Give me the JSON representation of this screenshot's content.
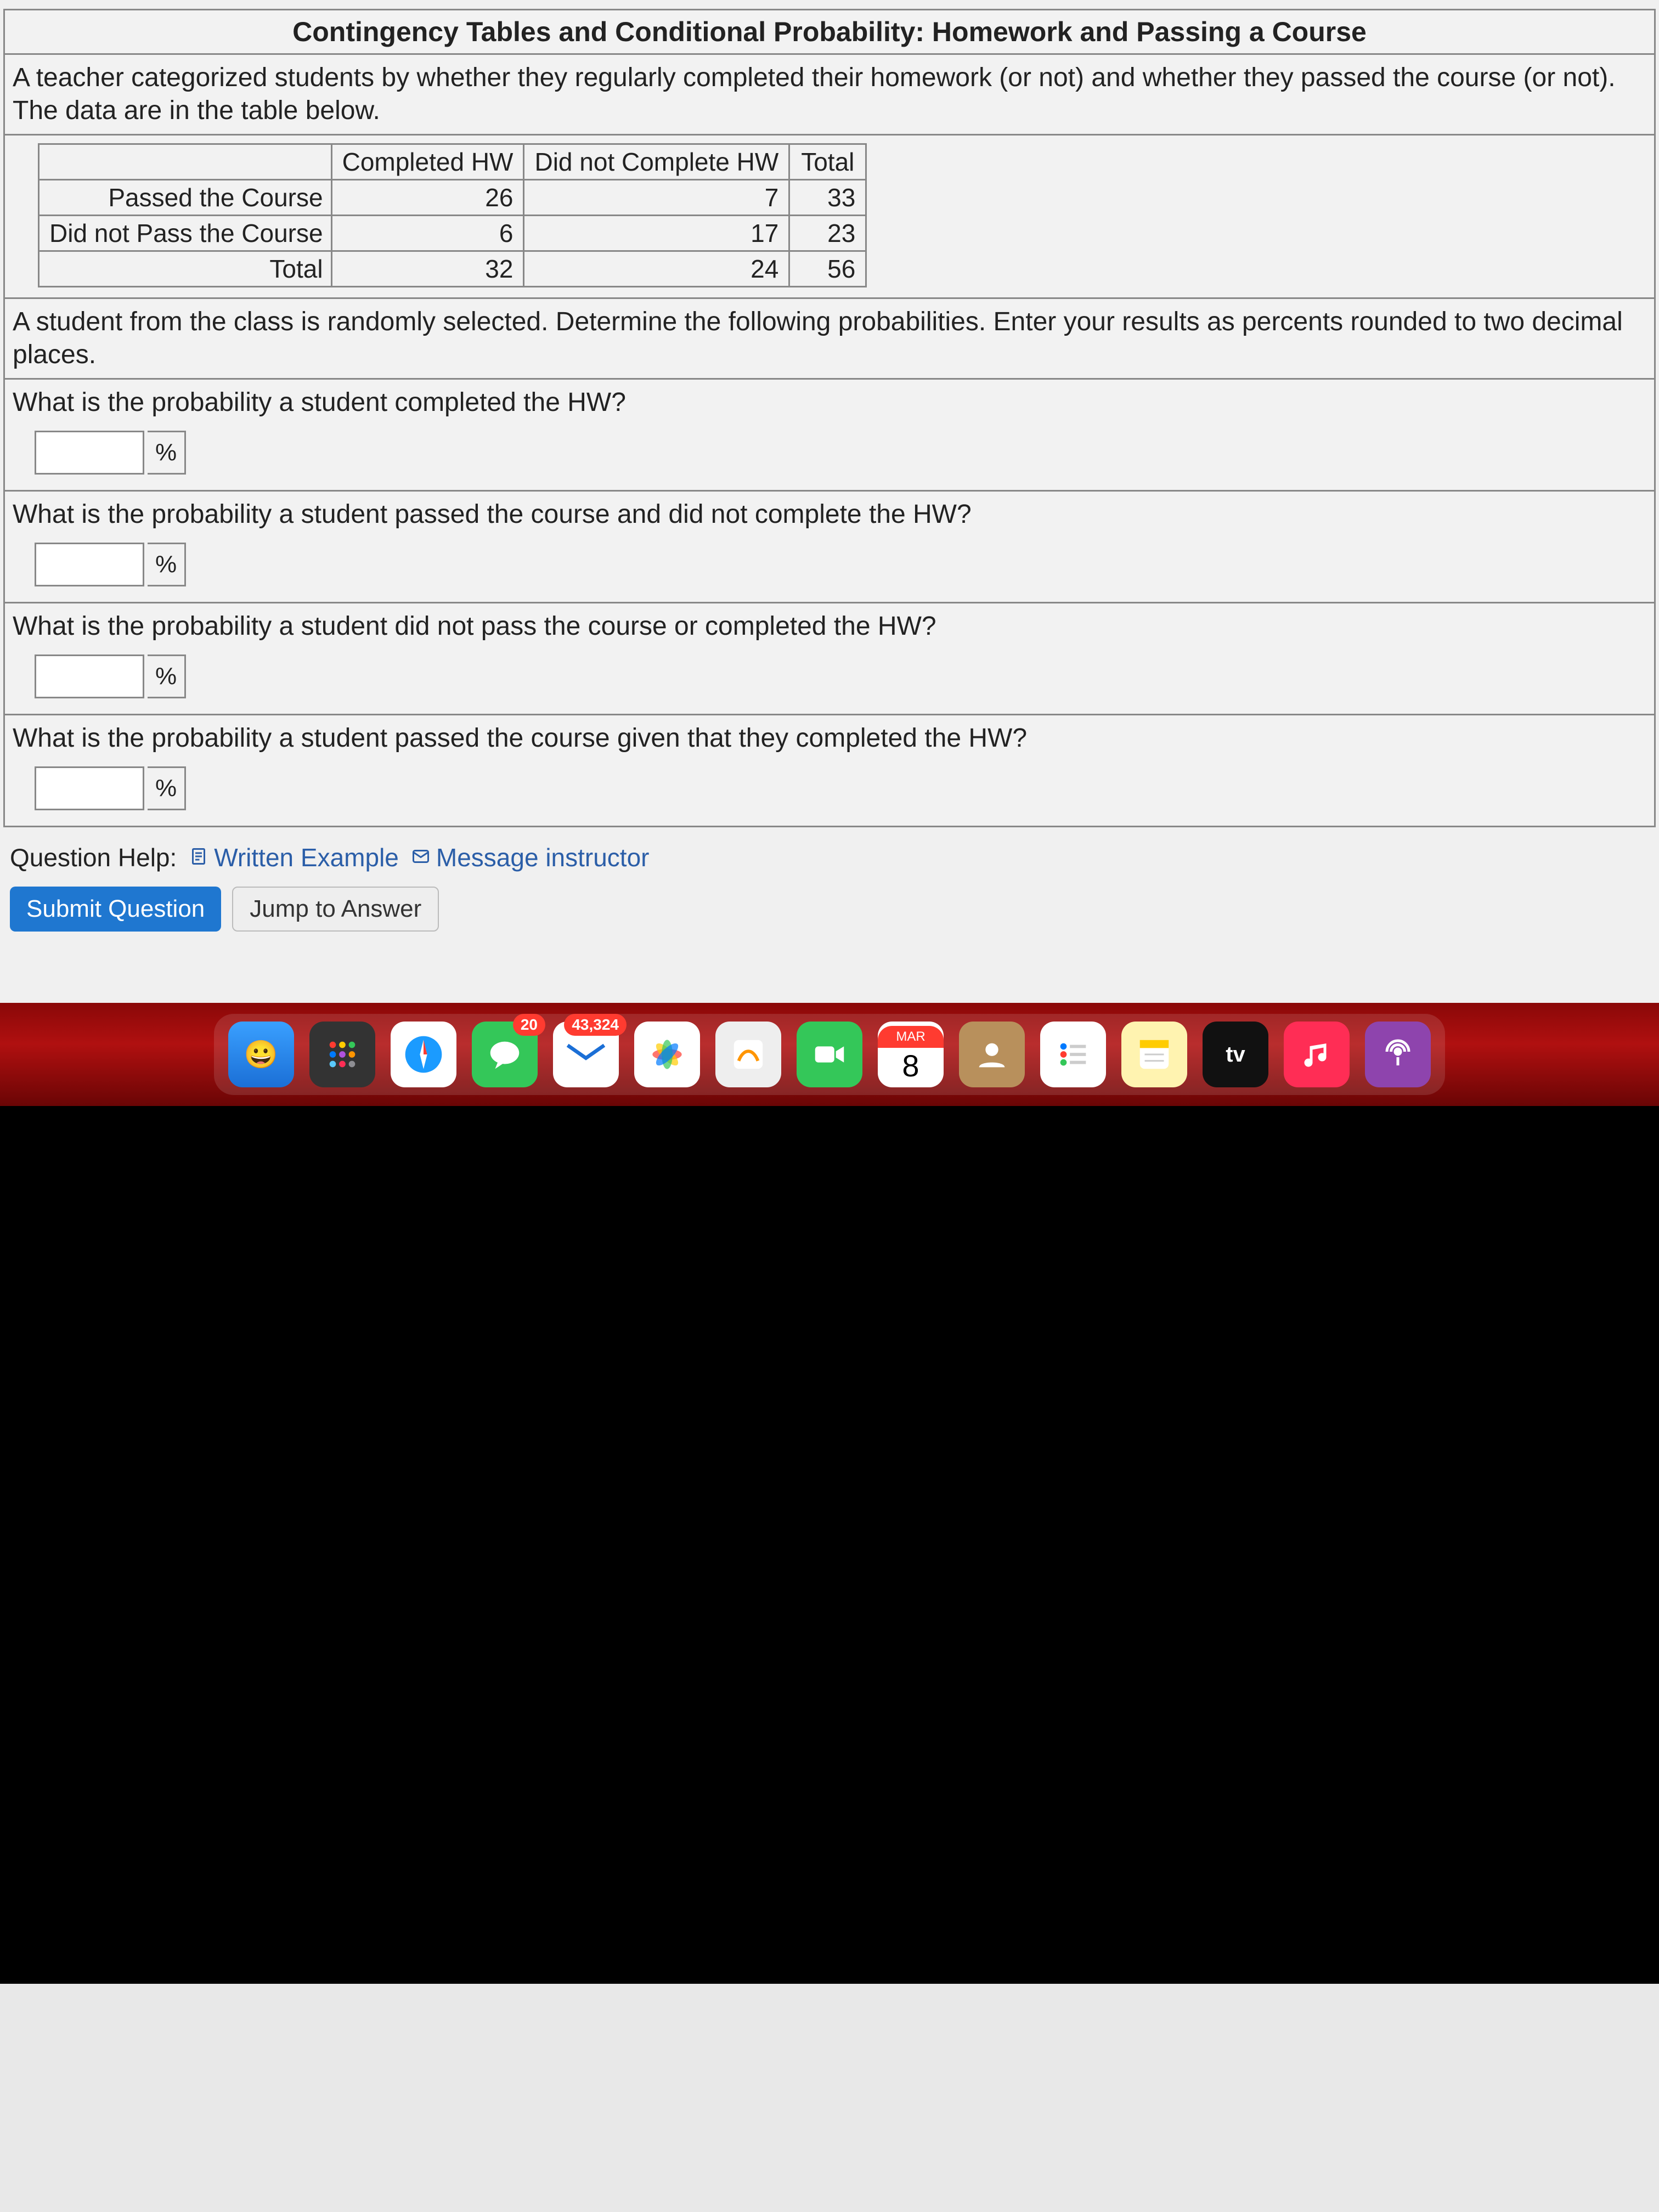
{
  "title": "Contingency Tables and Conditional Probability: Homework and Passing a Course",
  "intro": "A teacher categorized students by whether they regularly completed their homework (or not) and whether they passed the course (or not). The data are in the table below.",
  "table": {
    "col_headers": [
      "",
      "Completed HW",
      "Did not Complete HW",
      "Total"
    ],
    "rows": [
      {
        "label": "Passed the Course",
        "cells": [
          "26",
          "7",
          "33"
        ]
      },
      {
        "label": "Did not Pass the Course",
        "cells": [
          "6",
          "17",
          "23"
        ]
      },
      {
        "label": "Total",
        "cells": [
          "32",
          "24",
          "56"
        ]
      }
    ]
  },
  "instructions": "A student from the class is randomly selected. Determine the following probabilities. Enter your results as percents rounded to two decimal places.",
  "questions": [
    {
      "text": "What is the probability a student completed the HW?",
      "unit": "%"
    },
    {
      "text": "What is the probability a student passed the course and did not complete the HW?",
      "unit": "%"
    },
    {
      "text": "What is the probability a student did not pass the course or completed the HW?",
      "unit": "%"
    },
    {
      "text": "What is the probability a student passed the course given that they completed the HW?",
      "unit": "%"
    }
  ],
  "help": {
    "label": "Question Help:",
    "written": "Written Example",
    "message": "Message instructor"
  },
  "buttons": {
    "submit": "Submit Question",
    "jump": "Jump to Answer"
  },
  "dock": {
    "messages_badge": "20",
    "mail_badge": "43,324",
    "calendar_month": "MAR",
    "calendar_day": "8",
    "tv_label": "tv"
  }
}
